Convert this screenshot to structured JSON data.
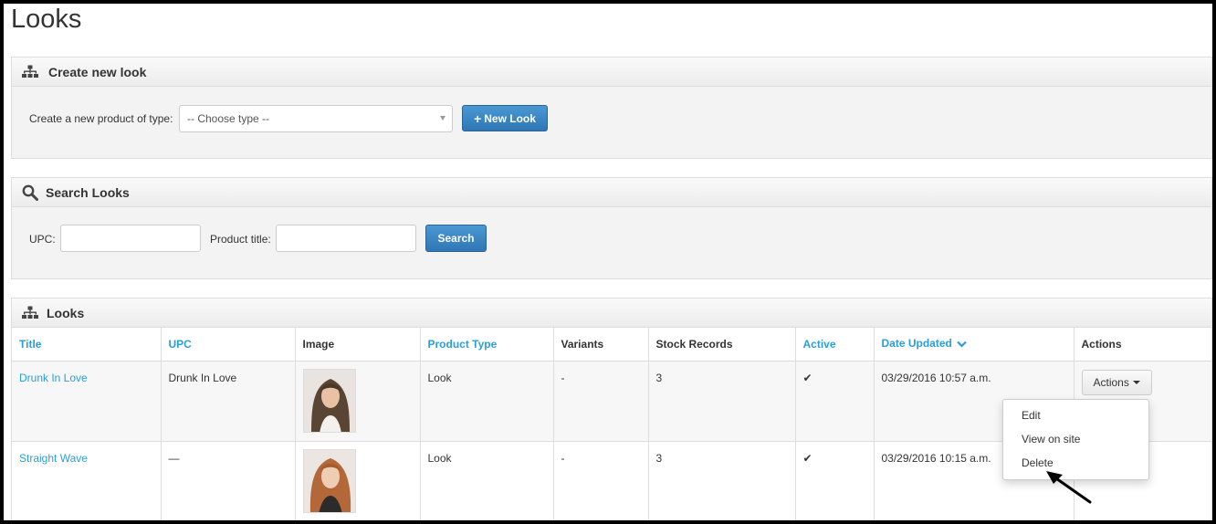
{
  "page": {
    "title": "Looks"
  },
  "create_panel": {
    "heading": "Create new look",
    "icon": "sitemap-icon",
    "type_label": "Create a new product of type:",
    "type_select_value": "-- Choose type --",
    "new_button_icon": "plus-icon",
    "new_button_label": "New Look"
  },
  "search_panel": {
    "heading": "Search Looks",
    "icon": "search-icon",
    "upc_label": "UPC:",
    "upc_value": "",
    "title_label": "Product title:",
    "title_value": "",
    "search_button_label": "Search"
  },
  "looks_panel": {
    "heading": "Looks",
    "icon": "sitemap-icon",
    "columns": [
      "Title",
      "UPC",
      "Image",
      "Product Type",
      "Variants",
      "Stock Records",
      "Active",
      "Date Updated",
      "Actions"
    ],
    "sort_icon": "chevron-down-icon",
    "rows": [
      {
        "title": "Drunk In Love",
        "upc": "Drunk In Love",
        "product_type": "Look",
        "variants": "-",
        "stock_records": "3",
        "active": "✔",
        "date_updated": "03/29/2016 10:57 a.m.",
        "image": "portrait-image"
      },
      {
        "title": "Straight Wave",
        "upc": "—",
        "product_type": "Look",
        "variants": "-",
        "stock_records": "3",
        "active": "✔",
        "date_updated": "03/29/2016 10:15 a.m.",
        "image": "portrait-image"
      }
    ],
    "actions_label": "Actions",
    "dropdown_items": [
      "Edit",
      "View on site",
      "Delete"
    ]
  },
  "colors": {
    "link": "#2a9fd6",
    "primary_button": "#337ab7",
    "panel_bg": "#f3f3f3"
  }
}
